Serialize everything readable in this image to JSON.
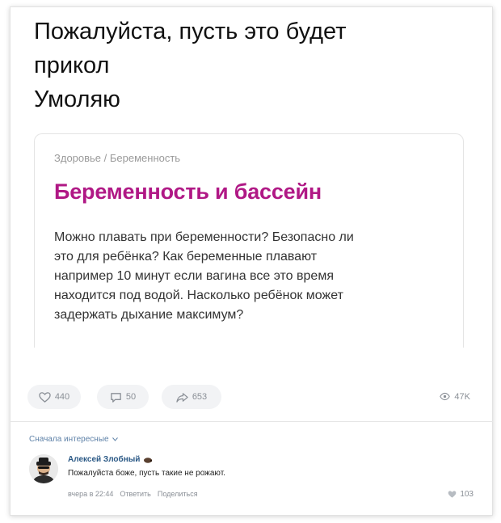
{
  "post": {
    "text_lines": [
      "Пожалуйста, пусть это будет",
      "прикол",
      "Умоляю"
    ]
  },
  "article": {
    "breadcrumb": "Здоровье / Беременность",
    "title": "Беременность и бассейн",
    "body_lines": [
      "Можно плавать при беременности? Безопасно ли",
      "это для ребёнка? Как беременные плавают",
      "например 10 минут если вагина все это время",
      "находится под водой. Насколько ребёнок может",
      "задержать дыхание максимум?"
    ],
    "title_color": "#b01885"
  },
  "actions": {
    "likes": "440",
    "comments": "50",
    "shares": "653",
    "views": "47K"
  },
  "comments": {
    "sort_label": "Сначала интересные",
    "items": [
      {
        "author": "Алексей Злобный",
        "text": "Пожалуйста боже, пусть такие не рожают.",
        "time": "вчера в 22:44",
        "reply": "Ответить",
        "share": "Поделиться",
        "likes": "103"
      }
    ]
  },
  "colors": {
    "accent_link": "#2a5885",
    "muted": "#8a8f96"
  }
}
